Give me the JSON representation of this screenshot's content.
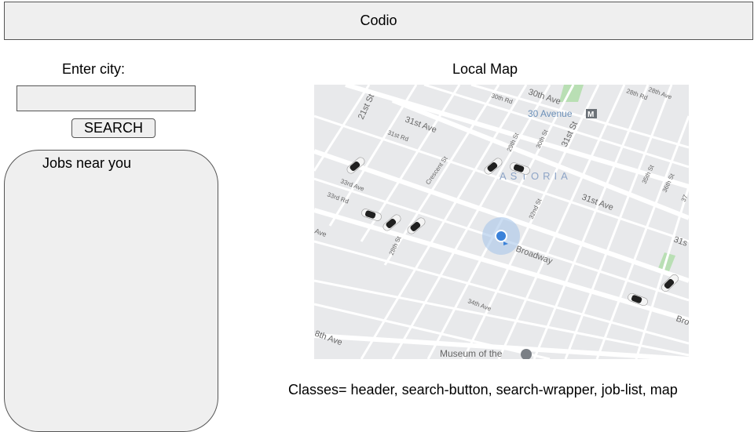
{
  "header": {
    "title": "Codio"
  },
  "search_wrapper": {
    "label": "Enter city:",
    "input_value": "",
    "button_label": "SEARCH"
  },
  "job_list": {
    "title": "Jobs near you"
  },
  "map": {
    "title": "Local Map",
    "street_labels": {
      "s21st": "21st St",
      "ave31": "31st Ave",
      "rd31": "31st Rd",
      "rd30": "30th Rd",
      "ave30": "30th Ave",
      "station": "30 Avenue",
      "station_mark": "M",
      "rd28": "28th Rd",
      "ave28": "28th Ave",
      "crescent": "Crescent St",
      "s29": "29th St",
      "s30": "30th St",
      "s31": "31st St",
      "astoria": "ASTORIA",
      "ave33": "33rd Ave",
      "rd33": "33rd Rd",
      "ave_left": "Ave",
      "s28": "28th St",
      "s32": "32nd St",
      "ave31_right": "31st Ave",
      "s35": "35th St",
      "s36": "36th St",
      "broadway": "Broadway",
      "ave34": "34th Ave",
      "ave_bottom_left": "8th Ave",
      "museum": "Museum of the",
      "right_edge_31": "31s",
      "right_edge_bro": "Bro",
      "right_edge_37": "37"
    }
  },
  "note": {
    "text": "Classes=  header, search-button, search-wrapper, job-list, map"
  }
}
